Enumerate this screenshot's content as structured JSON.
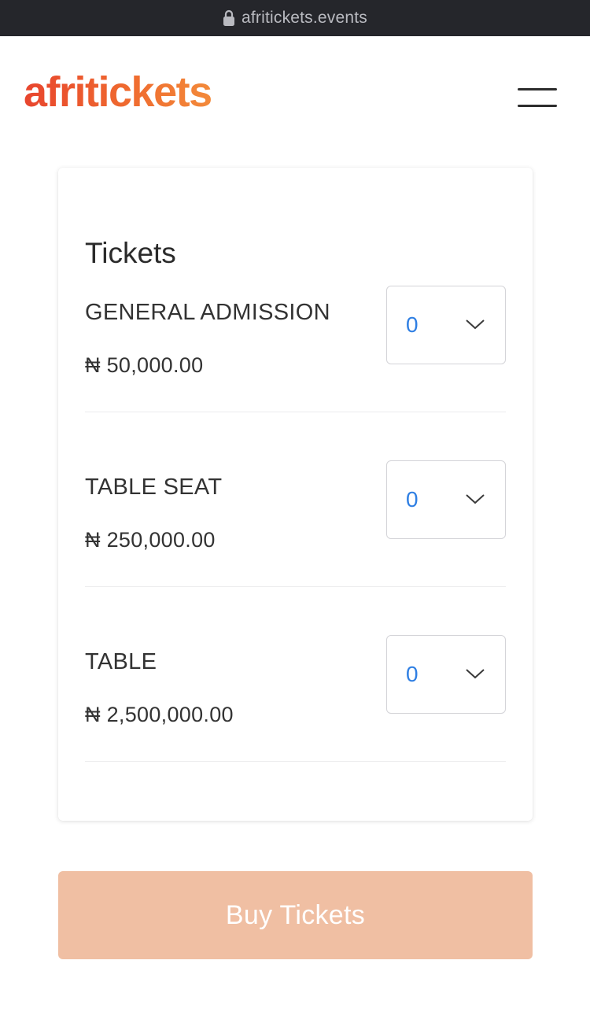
{
  "browser": {
    "url": "afritickets.events",
    "lock_icon": "lock-icon"
  },
  "header": {
    "logo_text": "afritickets",
    "menu_icon": "hamburger-menu-icon"
  },
  "tickets_section": {
    "title": "Tickets",
    "items": [
      {
        "name": "GENERAL ADMISSION",
        "price": "₦ 50,000.00",
        "quantity": "0"
      },
      {
        "name": "TABLE SEAT",
        "price": "₦ 250,000.00",
        "quantity": "0"
      },
      {
        "name": "TABLE",
        "price": "₦ 2,500,000.00",
        "quantity": "0"
      }
    ]
  },
  "actions": {
    "buy_label": "Buy Tickets"
  },
  "colors": {
    "brand_orange": "#ef6a2f",
    "quantity_blue": "#2f7fe3",
    "buy_button_bg": "#f0bfa3"
  }
}
